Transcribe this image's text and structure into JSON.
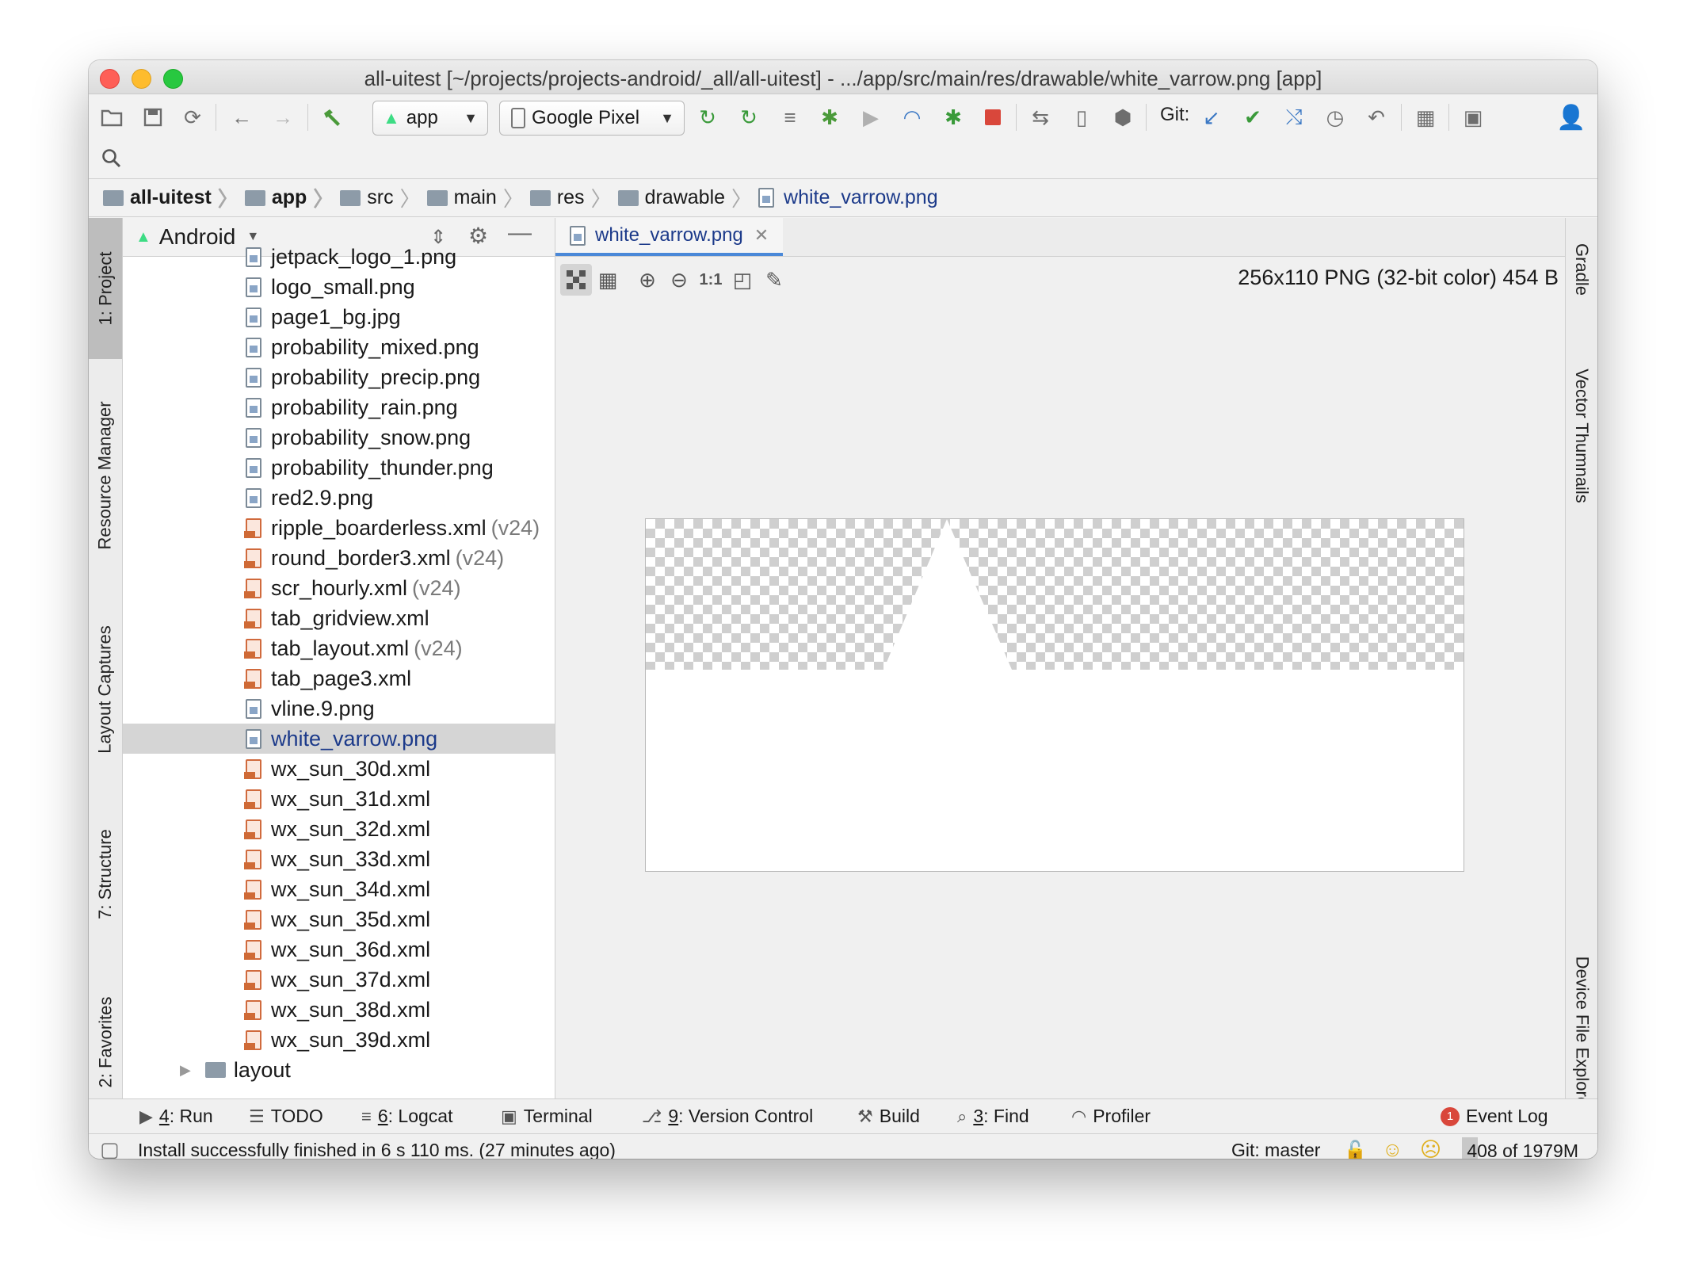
{
  "window": {
    "title": "all-uitest [~/projects/projects-android/_all/all-uitest] - .../app/src/main/res/drawable/white_varrow.png [app]"
  },
  "toolbar": {
    "run_config": "app",
    "device": "Google Pixel",
    "git_label": "Git:"
  },
  "breadcrumb": [
    {
      "label": "all-uitest"
    },
    {
      "label": "app"
    },
    {
      "label": "src"
    },
    {
      "label": "main"
    },
    {
      "label": "res"
    },
    {
      "label": "drawable"
    },
    {
      "label": "white_varrow.png"
    }
  ],
  "left_tool_tabs": [
    {
      "label": "1: Project"
    },
    {
      "label": "Resource Manager"
    },
    {
      "label": "Layout Captures"
    },
    {
      "label": "7: Structure"
    },
    {
      "label": "2: Favorites"
    }
  ],
  "right_tool_tabs": [
    {
      "label": "Gradle"
    },
    {
      "label": "Vector Thumnails"
    },
    {
      "label": "Device File Explorer"
    }
  ],
  "project_panel": {
    "view_mode": "Android",
    "files": [
      {
        "name": "jetpack_logo_1.png",
        "suffix": "",
        "type": "png"
      },
      {
        "name": "logo_small.png",
        "suffix": "",
        "type": "png"
      },
      {
        "name": "page1_bg.jpg",
        "suffix": "",
        "type": "png"
      },
      {
        "name": "probability_mixed.png",
        "suffix": "",
        "type": "png"
      },
      {
        "name": "probability_precip.png",
        "suffix": "",
        "type": "png"
      },
      {
        "name": "probability_rain.png",
        "suffix": "",
        "type": "png"
      },
      {
        "name": "probability_snow.png",
        "suffix": "",
        "type": "png"
      },
      {
        "name": "probability_thunder.png",
        "suffix": "",
        "type": "png"
      },
      {
        "name": "red2.9.png",
        "suffix": "",
        "type": "png"
      },
      {
        "name": "ripple_boarderless.xml",
        "suffix": "(v24)",
        "type": "xml"
      },
      {
        "name": "round_border3.xml",
        "suffix": "(v24)",
        "type": "xml"
      },
      {
        "name": "scr_hourly.xml",
        "suffix": "(v24)",
        "type": "xml"
      },
      {
        "name": "tab_gridview.xml",
        "suffix": "",
        "type": "xml"
      },
      {
        "name": "tab_layout.xml",
        "suffix": "(v24)",
        "type": "xml"
      },
      {
        "name": "tab_page3.xml",
        "suffix": "",
        "type": "xml"
      },
      {
        "name": "vline.9.png",
        "suffix": "",
        "type": "png"
      },
      {
        "name": "white_varrow.png",
        "suffix": "",
        "type": "png",
        "selected": true
      },
      {
        "name": "wx_sun_30d.xml",
        "suffix": "",
        "type": "xml"
      },
      {
        "name": "wx_sun_31d.xml",
        "suffix": "",
        "type": "xml"
      },
      {
        "name": "wx_sun_32d.xml",
        "suffix": "",
        "type": "xml"
      },
      {
        "name": "wx_sun_33d.xml",
        "suffix": "",
        "type": "xml"
      },
      {
        "name": "wx_sun_34d.xml",
        "suffix": "",
        "type": "xml"
      },
      {
        "name": "wx_sun_35d.xml",
        "suffix": "",
        "type": "xml"
      },
      {
        "name": "wx_sun_36d.xml",
        "suffix": "",
        "type": "xml"
      },
      {
        "name": "wx_sun_37d.xml",
        "suffix": "",
        "type": "xml"
      },
      {
        "name": "wx_sun_38d.xml",
        "suffix": "",
        "type": "xml"
      },
      {
        "name": "wx_sun_39d.xml",
        "suffix": "",
        "type": "xml"
      }
    ],
    "folder": "layout"
  },
  "editor": {
    "tab_label": "white_varrow.png",
    "zoom_actual_label": "1:1",
    "image_info": "256x110 PNG (32-bit color) 454 B"
  },
  "bottom_tools": [
    {
      "key": "4",
      "rest": ": Run",
      "icon": "run-icon"
    },
    {
      "key": "",
      "rest": "TODO",
      "icon": "todo-icon"
    },
    {
      "key": "6",
      "rest": ": Logcat",
      "icon": "logcat-icon"
    },
    {
      "key": "",
      "rest": "Terminal",
      "icon": "terminal-icon"
    },
    {
      "key": "9",
      "rest": ": Version Control",
      "icon": "vcs-icon"
    },
    {
      "key": "",
      "rest": "Build",
      "icon": "hammer-icon"
    },
    {
      "key": "3",
      "rest": ": Find",
      "icon": "search-icon"
    },
    {
      "key": "",
      "rest": "Profiler",
      "icon": "gauge-icon"
    }
  ],
  "event_log": {
    "count": "1",
    "label": "Event Log"
  },
  "status": {
    "message": "Install successfully finished in 6 s 110 ms. (27 minutes ago)",
    "git_branch": "Git: master",
    "memory": "408 of 1979M"
  },
  "colors": {
    "accent": "#4a88d8",
    "selected_text": "#1c3a8a",
    "xml_icon": "#d06a3d"
  }
}
